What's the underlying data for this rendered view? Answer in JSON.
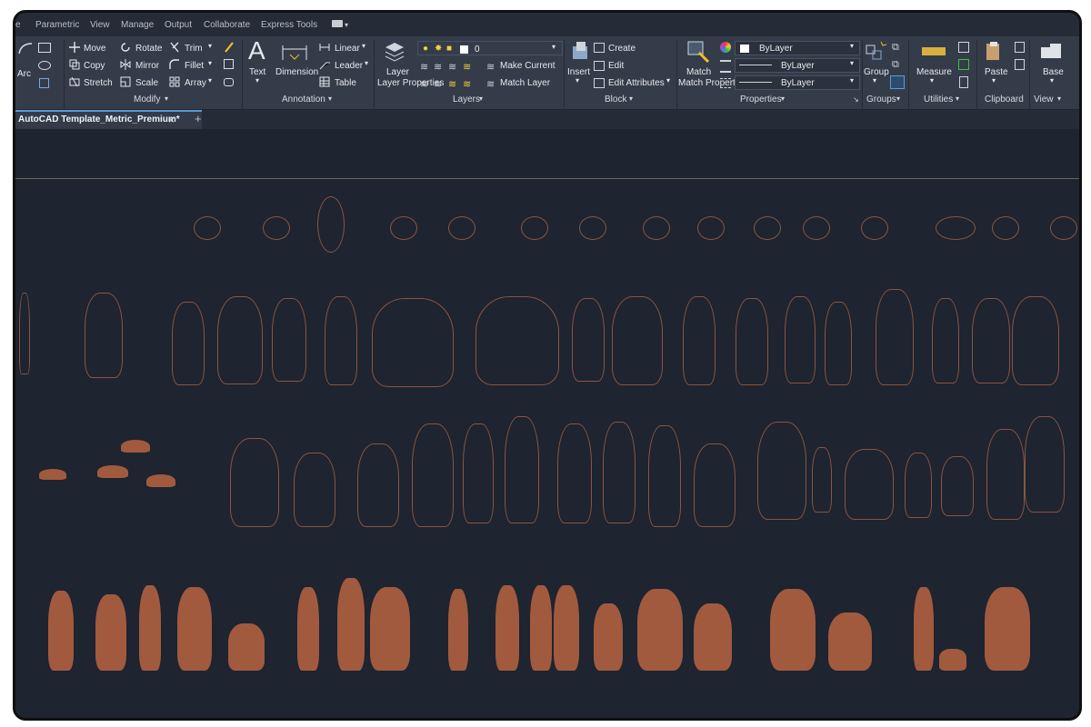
{
  "menu": [
    "e",
    "Parametric",
    "View",
    "Manage",
    "Output",
    "Collaborate",
    "Express Tools"
  ],
  "ribbon": {
    "draw": {
      "arc_label": "Arc"
    },
    "modify": {
      "title": "Modify",
      "items": [
        "Move",
        "Rotate",
        "Trim",
        "Copy",
        "Mirror",
        "Fillet",
        "Stretch",
        "Scale",
        "Array"
      ]
    },
    "annotation": {
      "title": "Annotation",
      "text_label": "Text",
      "dimension_label": "Dimension",
      "linear_label": "Linear",
      "leader_label": "Leader",
      "table_label": "Table"
    },
    "layers": {
      "title": "Layers",
      "layer_properties": "Layer Properties",
      "current_layer": "0",
      "make_current": "Make Current",
      "match_layer": "Match Layer"
    },
    "block": {
      "title": "Block",
      "insert": "Insert",
      "create": "Create",
      "edit": "Edit",
      "edit_attributes": "Edit Attributes"
    },
    "properties": {
      "title": "Properties",
      "match_properties": "Match Properties",
      "color": "ByLayer",
      "linetype": "ByLayer",
      "lineweight": "ByLayer"
    },
    "groups": {
      "title": "Groups",
      "group_label": "Group"
    },
    "utilities": {
      "title": "Utilities",
      "measure_label": "Measure"
    },
    "clipboard": {
      "title": "Clipboard",
      "paste_label": "Paste"
    },
    "view": {
      "title": "View",
      "base_label": "Base"
    }
  },
  "tabs": {
    "document": "AutoCAD Template_Metric_Premium*",
    "close_glyph": "×",
    "new_tab_glyph": "+"
  },
  "colors": {
    "background": "#1e2430",
    "ribbon": "#343c4a",
    "outline_figure": "#8a5640",
    "filled_figure": "#a15a3e",
    "accent": "#5b9bd5"
  }
}
